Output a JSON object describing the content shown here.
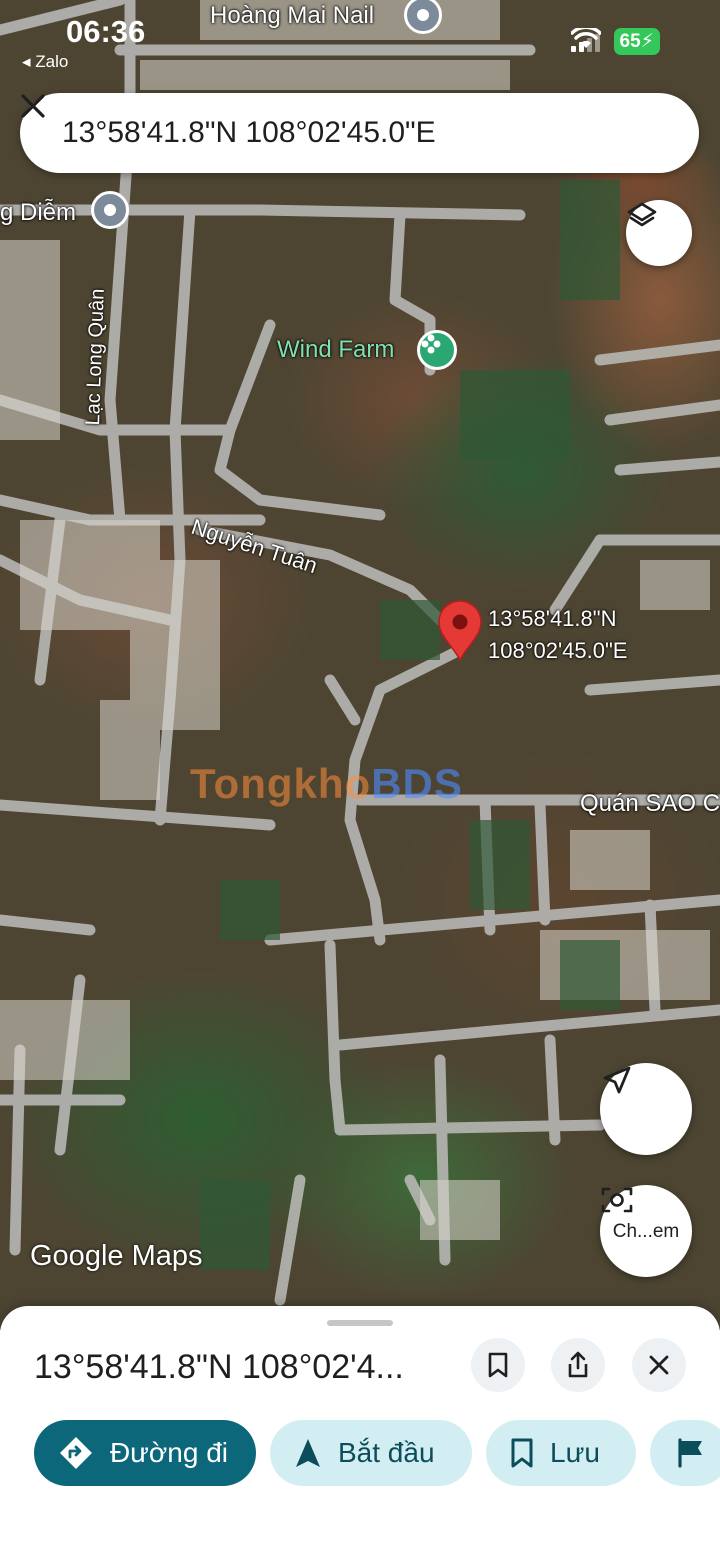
{
  "status_bar": {
    "time": "06:36",
    "back_app": "◂ Zalo",
    "battery": "65"
  },
  "search": {
    "query": "13°58'41.8\"N 108°02'45.0\"E"
  },
  "map": {
    "labels": {
      "hoang_mai_nail": "Hoàng Mai Nail",
      "diem": "g Diễm",
      "lac_long_quan": "Lạc Long Quân",
      "wind_farm": "Wind Farm",
      "nguyen_tuan": "Nguyễn Tuân",
      "quan_sao": "Quán SAO C"
    },
    "pin_coord_line1": "13°58'41.8\"N",
    "pin_coord_line2": "108°02'45.0\"E",
    "attribution": "Google Maps",
    "watermark_main": "Tongkho",
    "watermark_accent": "BDS",
    "lens_label": "Ch...em"
  },
  "sheet": {
    "title": "13°58'41.8\"N 108°02'4...",
    "chips": {
      "directions": "Đường đi",
      "start": "Bắt đầu",
      "save": "Lưu"
    }
  },
  "colors": {
    "primary_chip": "#0b6779",
    "secondary_chip": "#d3eef3",
    "pin": "#e53935",
    "battery": "#34c759"
  }
}
